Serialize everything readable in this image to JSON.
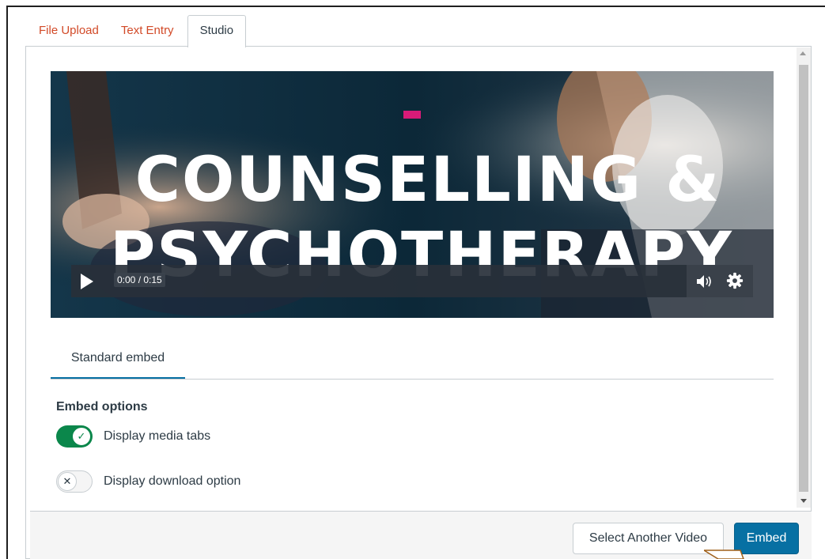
{
  "tabs": [
    {
      "label": "File Upload",
      "active": false
    },
    {
      "label": "Text Entry",
      "active": false
    },
    {
      "label": "Studio",
      "active": true
    }
  ],
  "video": {
    "title_line1": "COUNSELLING &",
    "title_line2": "PSYCHOTHERAPY",
    "time": "0:00 / 0:15",
    "icons": [
      "play-icon",
      "volume-icon",
      "settings-gear-icon"
    ]
  },
  "embed": {
    "tab_label": "Standard embed",
    "options_label": "Embed options",
    "options": [
      {
        "label": "Display media tabs",
        "enabled": true
      },
      {
        "label": "Display download option",
        "enabled": false
      }
    ]
  },
  "footer": {
    "select_another_label": "Select Another Video",
    "embed_label": "Embed"
  },
  "colors": {
    "tab_link": "#d24a28",
    "accent_blue": "#0770a3",
    "toggle_on": "#0b874b",
    "video_bg": "#0e2b3b",
    "brand_pink": "#d81b78"
  }
}
